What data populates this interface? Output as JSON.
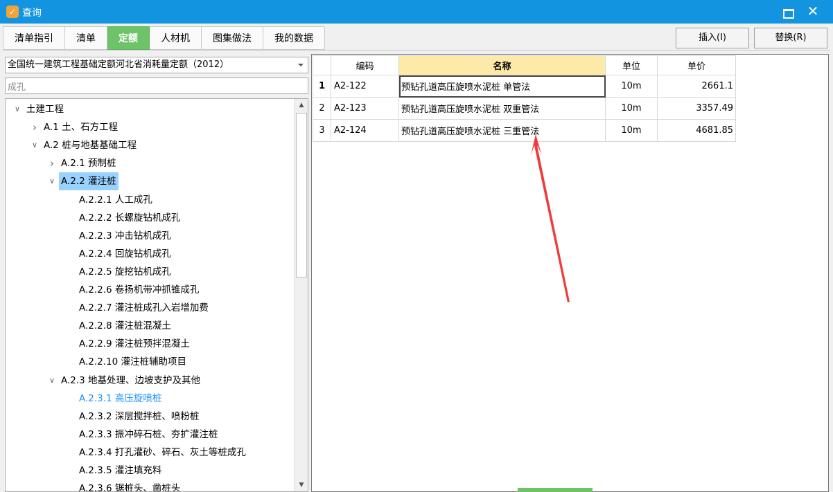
{
  "window": {
    "title": "查询",
    "icon": "app-logo-icon"
  },
  "tabs": [
    {
      "label": "清单指引",
      "active": false
    },
    {
      "label": "清单",
      "active": false
    },
    {
      "label": "定额",
      "active": true
    },
    {
      "label": "人材机",
      "active": false
    },
    {
      "label": "图集做法",
      "active": false
    },
    {
      "label": "我的数据",
      "active": false
    }
  ],
  "toolbar": {
    "insert_label": "插入(I)",
    "replace_label": "替换(R)"
  },
  "dict_select": {
    "value": "全国统一建筑工程基础定额河北省消耗量定额（2012）"
  },
  "search": {
    "value": "成孔"
  },
  "tree": [
    {
      "label": "土建工程",
      "level": 0,
      "expand": "open"
    },
    {
      "label": "A.1 土、石方工程",
      "level": 1,
      "expand": "closed"
    },
    {
      "label": "A.2 桩与地基基础工程",
      "level": 1,
      "expand": "open"
    },
    {
      "label": "A.2.1 预制桩",
      "level": 2,
      "expand": "closed"
    },
    {
      "label": "A.2.2 灌注桩",
      "level": 2,
      "expand": "open",
      "selected": true
    },
    {
      "label": "A.2.2.1 人工成孔",
      "level": 3
    },
    {
      "label": "A.2.2.2 长螺旋钻机成孔",
      "level": 3
    },
    {
      "label": "A.2.2.3 冲击钻机成孔",
      "level": 3
    },
    {
      "label": "A.2.2.4 回旋钻机成孔",
      "level": 3
    },
    {
      "label": "A.2.2.5 旋挖钻机成孔",
      "level": 3
    },
    {
      "label": "A.2.2.6 卷扬机带冲抓锥成孔",
      "level": 3
    },
    {
      "label": "A.2.2.7 灌注桩成孔入岩增加费",
      "level": 3
    },
    {
      "label": "A.2.2.8 灌注桩混凝土",
      "level": 3
    },
    {
      "label": "A.2.2.9 灌注桩预拌混凝土",
      "level": 3
    },
    {
      "label": "A.2.2.10 灌注桩辅助项目",
      "level": 3
    },
    {
      "label": "A.2.3 地基处理、边坡支护及其他",
      "level": 2,
      "expand": "open"
    },
    {
      "label": "A.2.3.1 高压旋喷桩",
      "level": 3,
      "current": true
    },
    {
      "label": "A.2.3.2 深层搅拌桩、喷粉桩",
      "level": 3
    },
    {
      "label": "A.2.3.3 振冲碎石桩、夯扩灌注桩",
      "level": 3
    },
    {
      "label": "A.2.3.4 打孔灌砂、碎石、灰土等桩成孔",
      "level": 3
    },
    {
      "label": "A.2.3.5 灌注填充料",
      "level": 3
    },
    {
      "label": "A.2.3.6 锯桩头、凿桩头",
      "level": 3
    }
  ],
  "grid": {
    "headers": {
      "code": "编码",
      "name": "名称",
      "unit": "单位",
      "price": "单价"
    },
    "rows": [
      {
        "num": "1",
        "code": "A2-122",
        "name": "预钻孔道高压旋喷水泥桩 单管法",
        "unit": "10m",
        "price": "2661.1"
      },
      {
        "num": "2",
        "code": "A2-123",
        "name": "预钻孔道高压旋喷水泥桩 双重管法",
        "unit": "10m",
        "price": "3357.49"
      },
      {
        "num": "3",
        "code": "A2-124",
        "name": "预钻孔道高压旋喷水泥桩 三重管法",
        "unit": "10m",
        "price": "4681.85"
      }
    ]
  },
  "colors": {
    "titlebar": "#1294e0",
    "active_tab": "#6ec268",
    "selected_node": "#99d1ff",
    "current_node_text": "#1e90ff",
    "name_header": "#fde9a8",
    "annotation_arrow": "#ef3b3b"
  }
}
